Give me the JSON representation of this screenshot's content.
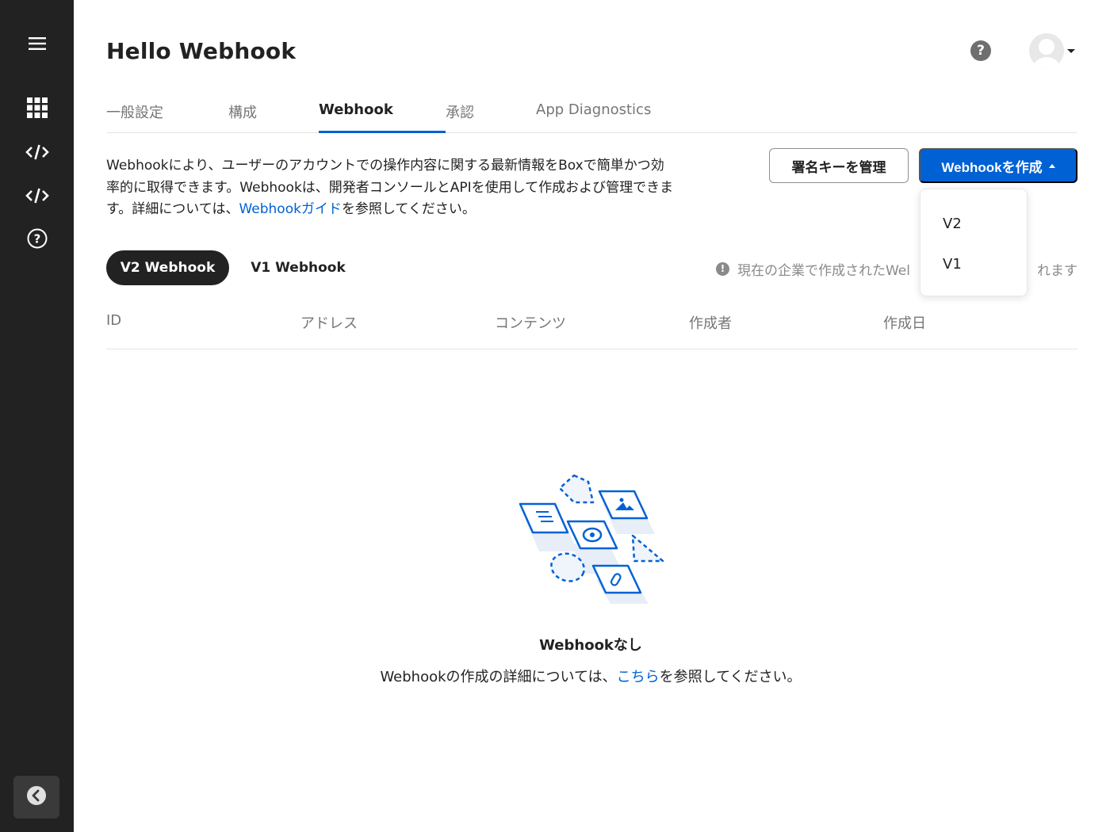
{
  "sidebar": {
    "items": [
      {
        "icon": "menu-icon"
      },
      {
        "icon": "apps-grid-icon"
      },
      {
        "icon": "code-icon"
      },
      {
        "icon": "code-icon"
      },
      {
        "icon": "help-circle-icon"
      }
    ],
    "collapse_icon": "chevron-left-icon"
  },
  "header": {
    "title": "Hello Webhook",
    "help_label": "?"
  },
  "tabs": [
    {
      "label": "一般設定"
    },
    {
      "label": "構成"
    },
    {
      "label": "Webhook",
      "active": true
    },
    {
      "label": "承認"
    },
    {
      "label": "App Diagnostics"
    }
  ],
  "description": {
    "text_before": "Webhookにより、ユーザーのアカウントでの操作内容に関する最新情報をBoxで簡単かつ効率的に取得できます。Webhookは、開発者コンソールとAPIを使用して作成および管理できます。詳細については、",
    "link_text": "Webhookガイド",
    "text_after": "を参照してください。"
  },
  "actions": {
    "manage_keys_label": "署名キーを管理",
    "create_webhook_label": "Webhookを作成"
  },
  "create_dropdown": {
    "options": [
      "V2",
      "V1"
    ]
  },
  "version_pills": [
    {
      "label": "V2 Webhook",
      "active": true
    },
    {
      "label": "V1 Webhook",
      "active": false
    }
  ],
  "notice": {
    "icon_label": "!",
    "text": "現在の企業で作成されたWel",
    "text_tail": "れます"
  },
  "table": {
    "columns": [
      "ID",
      "アドレス",
      "コンテンツ",
      "作成者",
      "作成日"
    ]
  },
  "empty_state": {
    "title": "Webhookなし",
    "text_before": "Webhookの作成の詳細については、",
    "link_text": "こちら",
    "text_after": "を参照してください。"
  },
  "colors": {
    "sidebar_bg": "#222222",
    "accent": "#0061d5",
    "muted_text": "#767676"
  }
}
